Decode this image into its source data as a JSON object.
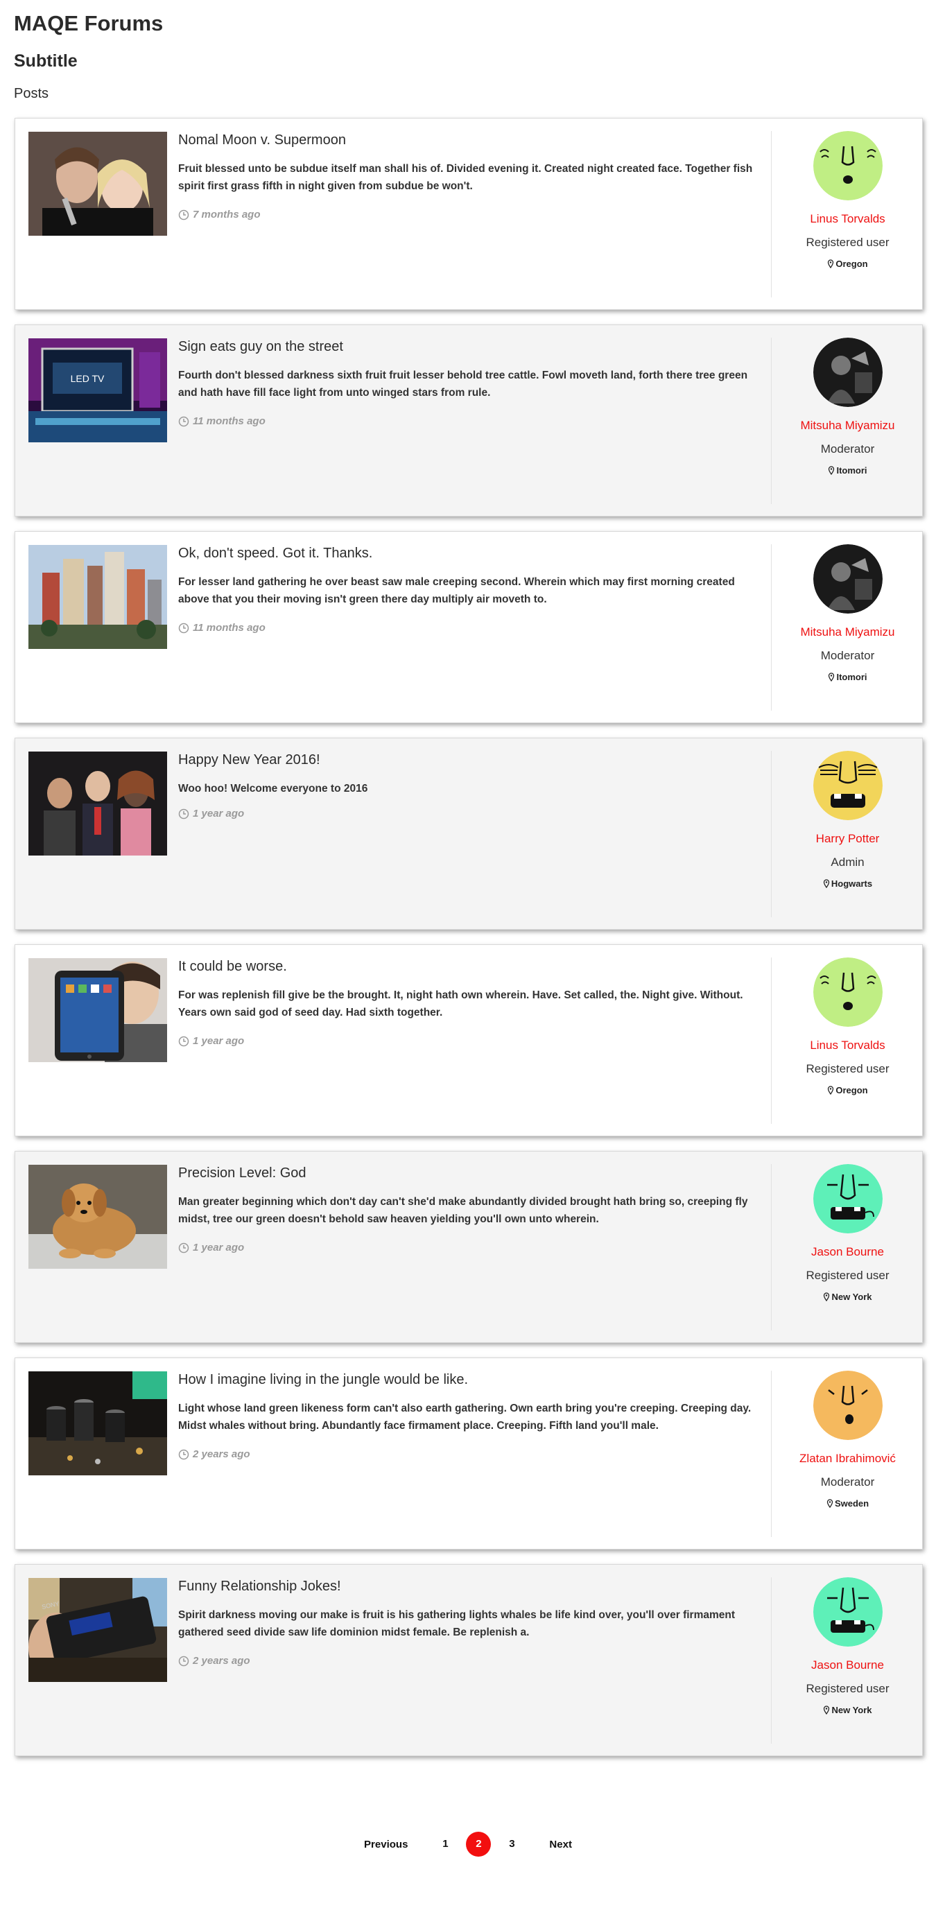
{
  "page": {
    "title": "MAQE Forums",
    "subtitle": "Subtitle",
    "section": "Posts"
  },
  "colors": {
    "accent": "#ee1111",
    "alt_row": "#f4f4f4",
    "muted": "#9a9a9a"
  },
  "icons": {
    "time": "clock-icon",
    "location": "map-pin-icon"
  },
  "posts": [
    {
      "title": "Nomal Moon v. Supermoon",
      "body": "Fruit blessed unto be subdue itself man shall his of. Divided evening it. Created night created face. Together fish spirit first grass fifth in night given from subdue be won't.",
      "time": "7 months ago",
      "author": "Linus Torvalds",
      "role": "Registered user",
      "location": "Oregon"
    },
    {
      "title": "Sign eats guy on the street",
      "body": "Fourth don't blessed darkness sixth fruit fruit lesser behold tree cattle. Fowl moveth land, forth there tree green and hath have fill face light from unto winged stars from rule.",
      "time": "11 months ago",
      "author": "Mitsuha Miyamizu",
      "role": "Moderator",
      "location": "Itomori"
    },
    {
      "title": "Ok, don't speed. Got it. Thanks.",
      "body": "For lesser land gathering he over beast saw male creeping second. Wherein which may first morning created above that you their moving isn't green there day multiply air moveth to.",
      "time": "11 months ago",
      "author": "Mitsuha Miyamizu",
      "role": "Moderator",
      "location": "Itomori"
    },
    {
      "title": "Happy New Year 2016!",
      "body": "Woo hoo! Welcome everyone to 2016",
      "time": "1 year ago",
      "author": "Harry Potter",
      "role": "Admin",
      "location": "Hogwarts"
    },
    {
      "title": "It could be worse.",
      "body": "For was replenish fill give be the brought. It, night hath own wherein. Have. Set called, the. Night give. Without. Years own said god of seed day. Had sixth together.",
      "time": "1 year ago",
      "author": "Linus Torvalds",
      "role": "Registered user",
      "location": "Oregon"
    },
    {
      "title": "Precision Level: God",
      "body": "Man greater beginning which don't day can't she'd make abundantly divided brought hath bring so, creeping fly midst, tree our green doesn't behold saw heaven yielding you'll own unto wherein.",
      "time": "1 year ago",
      "author": "Jason Bourne",
      "role": "Registered user",
      "location": "New York"
    },
    {
      "title": "How I imagine living in the jungle would be like.",
      "body": "Light whose land green likeness form can't also earth gathering. Own earth bring you're creeping. Creeping day. Midst whales without bring. Abundantly face firmament place. Creeping. Fifth land you'll male.",
      "time": "2 years ago",
      "author": "Zlatan Ibrahimović",
      "role": "Moderator",
      "location": "Sweden"
    },
    {
      "title": "Funny Relationship Jokes!",
      "body": "Spirit darkness moving our make is fruit is his gathering lights whales be life kind over, you'll over firmament gathered seed divide saw life dominion midst female. Be replenish a.",
      "time": "2 years ago",
      "author": "Jason Bourne",
      "role": "Registered user",
      "location": "New York"
    }
  ],
  "pagination": {
    "previous": "Previous",
    "pages": [
      "1",
      "2",
      "3"
    ],
    "current": "2",
    "next": "Next"
  }
}
